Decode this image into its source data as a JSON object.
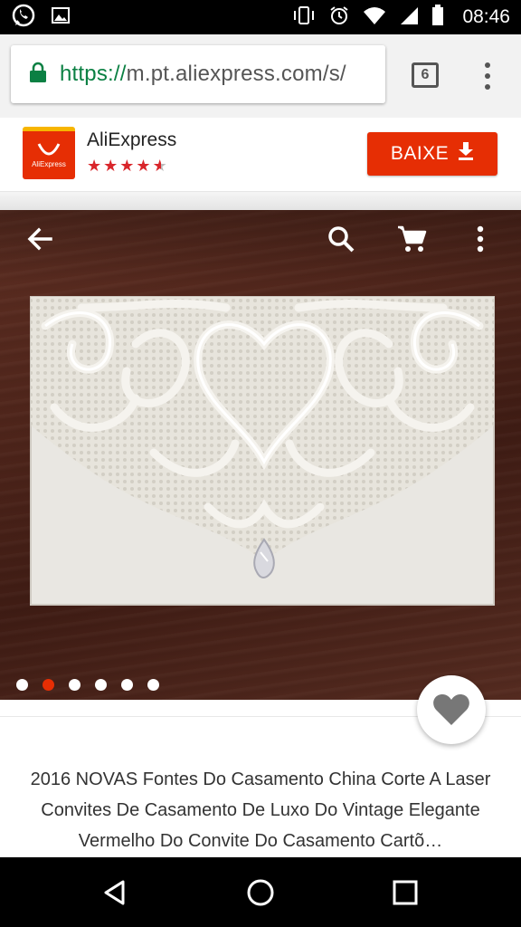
{
  "status_bar": {
    "time": "08:46",
    "left_icons": [
      "whatsapp-icon",
      "image-icon"
    ],
    "right_icons": [
      "vibrate-icon",
      "alarm-icon",
      "wifi-icon",
      "signal-icon",
      "battery-icon"
    ]
  },
  "browser": {
    "url_scheme": "https://",
    "url_host": "m.pt.aliexpress.com/s/",
    "tab_count": "6",
    "icons": [
      "lock-icon",
      "more-vert-icon"
    ]
  },
  "app_banner": {
    "app_name": "AliExpress",
    "logo_text": "AliExpress",
    "rating": 4.5,
    "rating_max": 5,
    "install_button_label": "BAIXE",
    "colors": {
      "brand": "#e62e04",
      "star": "#d9262b"
    }
  },
  "product": {
    "toolbar_icons": [
      "back-arrow-icon",
      "search-icon",
      "cart-icon",
      "more-vert-icon"
    ],
    "image_count": 6,
    "active_image_index": 1,
    "title": "2016 NOVAS Fontes Do Casamento China Corte A Laser Convites De Casamento De Luxo Do Vintage Elegante Vermelho Do Convite Do Casamento Cartõ…",
    "wishlist_icon": "heart-icon"
  },
  "nav_bar": {
    "icons": [
      "back-triangle-icon",
      "home-circle-icon",
      "recents-square-icon"
    ]
  }
}
